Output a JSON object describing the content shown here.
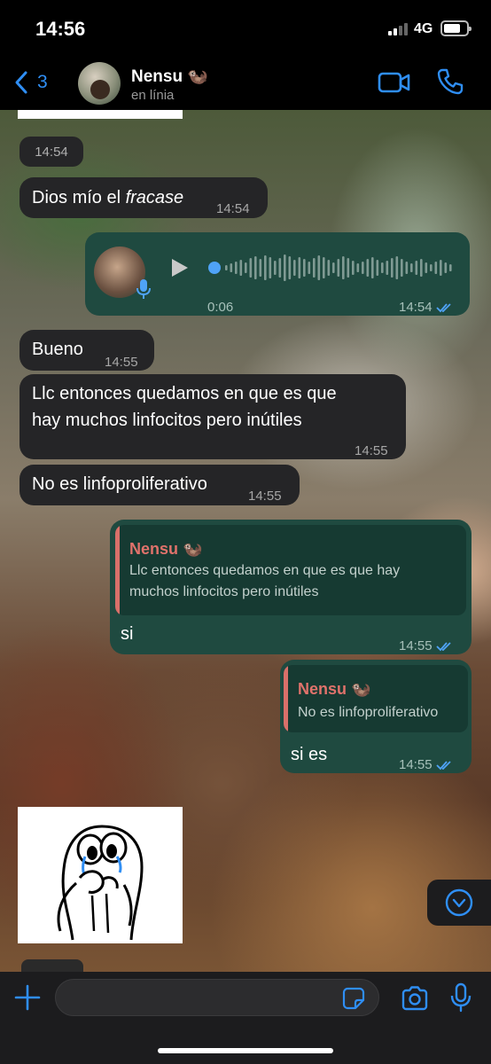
{
  "status_bar": {
    "time": "14:56",
    "network": "4G"
  },
  "header": {
    "back_count": "3",
    "contact_name": "Nensu 🦦",
    "contact_status": "en línia"
  },
  "messages": {
    "date_chip": "14:54",
    "m1": {
      "text_prefix": "Dios mío el ",
      "text_italic": "fracase",
      "time": "14:54"
    },
    "voice": {
      "duration": "0:06",
      "time": "14:54"
    },
    "m2": {
      "text": "Bueno",
      "time": "14:55"
    },
    "m3": {
      "line1": "Llc entonces quedamos en que es que",
      "line2": "hay muchos linfocitos pero inútiles",
      "time": "14:55"
    },
    "m4": {
      "text": "No es linfoproliferativo",
      "time": "14:55"
    },
    "r1": {
      "quote_name": "Nensu 🦦",
      "quote_line1": "Llc entonces quedamos en que es que hay",
      "quote_line2": "muchos linfocitos pero inútiles",
      "text": "si",
      "time": "14:55"
    },
    "r2": {
      "quote_name": "Nensu 🦦",
      "quote_line1": "No es linfoproliferativo",
      "text": "si es",
      "time": "14:55"
    }
  },
  "colors": {
    "accent": "#2f8ef4",
    "incoming_bubble": "#252527",
    "outgoing_bubble": "#1f4a40",
    "read_ticks": "#4fa3f7",
    "quote_name": "#e0726b"
  },
  "icons": [
    "chevron-left-icon",
    "video-icon",
    "phone-icon",
    "play-icon",
    "mic-icon",
    "double-check-icon",
    "chevron-down-circle-icon",
    "plus-icon",
    "sticker-icon",
    "camera-icon"
  ]
}
